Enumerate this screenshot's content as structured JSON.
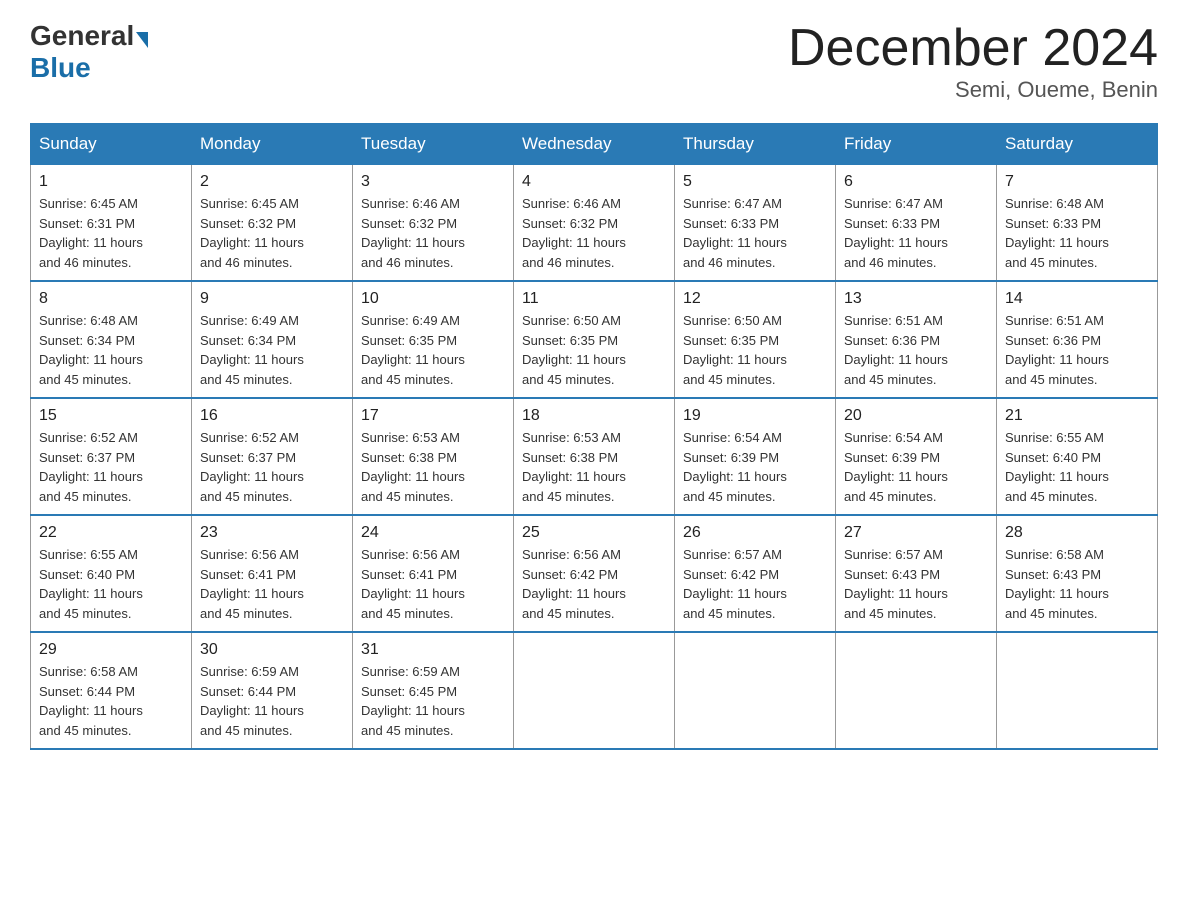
{
  "logo": {
    "general": "General",
    "blue": "Blue"
  },
  "title": "December 2024",
  "subtitle": "Semi, Oueme, Benin",
  "days_header": [
    "Sunday",
    "Monday",
    "Tuesday",
    "Wednesday",
    "Thursday",
    "Friday",
    "Saturday"
  ],
  "weeks": [
    [
      {
        "num": "1",
        "sunrise": "6:45 AM",
        "sunset": "6:31 PM",
        "daylight": "11 hours and 46 minutes."
      },
      {
        "num": "2",
        "sunrise": "6:45 AM",
        "sunset": "6:32 PM",
        "daylight": "11 hours and 46 minutes."
      },
      {
        "num": "3",
        "sunrise": "6:46 AM",
        "sunset": "6:32 PM",
        "daylight": "11 hours and 46 minutes."
      },
      {
        "num": "4",
        "sunrise": "6:46 AM",
        "sunset": "6:32 PM",
        "daylight": "11 hours and 46 minutes."
      },
      {
        "num": "5",
        "sunrise": "6:47 AM",
        "sunset": "6:33 PM",
        "daylight": "11 hours and 46 minutes."
      },
      {
        "num": "6",
        "sunrise": "6:47 AM",
        "sunset": "6:33 PM",
        "daylight": "11 hours and 46 minutes."
      },
      {
        "num": "7",
        "sunrise": "6:48 AM",
        "sunset": "6:33 PM",
        "daylight": "11 hours and 45 minutes."
      }
    ],
    [
      {
        "num": "8",
        "sunrise": "6:48 AM",
        "sunset": "6:34 PM",
        "daylight": "11 hours and 45 minutes."
      },
      {
        "num": "9",
        "sunrise": "6:49 AM",
        "sunset": "6:34 PM",
        "daylight": "11 hours and 45 minutes."
      },
      {
        "num": "10",
        "sunrise": "6:49 AM",
        "sunset": "6:35 PM",
        "daylight": "11 hours and 45 minutes."
      },
      {
        "num": "11",
        "sunrise": "6:50 AM",
        "sunset": "6:35 PM",
        "daylight": "11 hours and 45 minutes."
      },
      {
        "num": "12",
        "sunrise": "6:50 AM",
        "sunset": "6:35 PM",
        "daylight": "11 hours and 45 minutes."
      },
      {
        "num": "13",
        "sunrise": "6:51 AM",
        "sunset": "6:36 PM",
        "daylight": "11 hours and 45 minutes."
      },
      {
        "num": "14",
        "sunrise": "6:51 AM",
        "sunset": "6:36 PM",
        "daylight": "11 hours and 45 minutes."
      }
    ],
    [
      {
        "num": "15",
        "sunrise": "6:52 AM",
        "sunset": "6:37 PM",
        "daylight": "11 hours and 45 minutes."
      },
      {
        "num": "16",
        "sunrise": "6:52 AM",
        "sunset": "6:37 PM",
        "daylight": "11 hours and 45 minutes."
      },
      {
        "num": "17",
        "sunrise": "6:53 AM",
        "sunset": "6:38 PM",
        "daylight": "11 hours and 45 minutes."
      },
      {
        "num": "18",
        "sunrise": "6:53 AM",
        "sunset": "6:38 PM",
        "daylight": "11 hours and 45 minutes."
      },
      {
        "num": "19",
        "sunrise": "6:54 AM",
        "sunset": "6:39 PM",
        "daylight": "11 hours and 45 minutes."
      },
      {
        "num": "20",
        "sunrise": "6:54 AM",
        "sunset": "6:39 PM",
        "daylight": "11 hours and 45 minutes."
      },
      {
        "num": "21",
        "sunrise": "6:55 AM",
        "sunset": "6:40 PM",
        "daylight": "11 hours and 45 minutes."
      }
    ],
    [
      {
        "num": "22",
        "sunrise": "6:55 AM",
        "sunset": "6:40 PM",
        "daylight": "11 hours and 45 minutes."
      },
      {
        "num": "23",
        "sunrise": "6:56 AM",
        "sunset": "6:41 PM",
        "daylight": "11 hours and 45 minutes."
      },
      {
        "num": "24",
        "sunrise": "6:56 AM",
        "sunset": "6:41 PM",
        "daylight": "11 hours and 45 minutes."
      },
      {
        "num": "25",
        "sunrise": "6:56 AM",
        "sunset": "6:42 PM",
        "daylight": "11 hours and 45 minutes."
      },
      {
        "num": "26",
        "sunrise": "6:57 AM",
        "sunset": "6:42 PM",
        "daylight": "11 hours and 45 minutes."
      },
      {
        "num": "27",
        "sunrise": "6:57 AM",
        "sunset": "6:43 PM",
        "daylight": "11 hours and 45 minutes."
      },
      {
        "num": "28",
        "sunrise": "6:58 AM",
        "sunset": "6:43 PM",
        "daylight": "11 hours and 45 minutes."
      }
    ],
    [
      {
        "num": "29",
        "sunrise": "6:58 AM",
        "sunset": "6:44 PM",
        "daylight": "11 hours and 45 minutes."
      },
      {
        "num": "30",
        "sunrise": "6:59 AM",
        "sunset": "6:44 PM",
        "daylight": "11 hours and 45 minutes."
      },
      {
        "num": "31",
        "sunrise": "6:59 AM",
        "sunset": "6:45 PM",
        "daylight": "11 hours and 45 minutes."
      },
      null,
      null,
      null,
      null
    ]
  ],
  "labels": {
    "sunrise": "Sunrise:",
    "sunset": "Sunset:",
    "daylight": "Daylight:"
  }
}
